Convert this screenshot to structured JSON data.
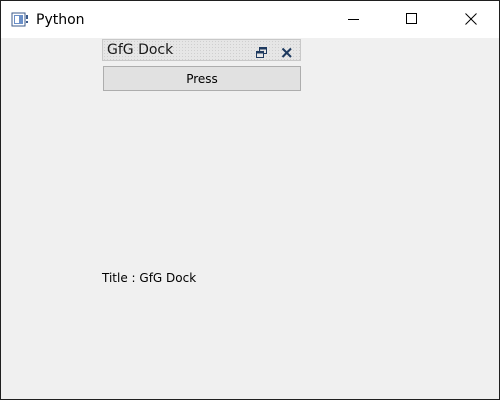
{
  "window": {
    "title": "Python",
    "icon": "python-app-icon",
    "controls": [
      "minimize-icon",
      "maximize-icon",
      "close-icon"
    ]
  },
  "dock": {
    "title": "GfG Dock",
    "float_icon": "float-icon",
    "close_icon": "close-icon"
  },
  "button": {
    "label": "Press"
  },
  "label": {
    "text": "Title : GfG Dock"
  },
  "colors": {
    "background": "#f0f0f0",
    "titlebar": "#ffffff",
    "button": "#e1e1e1",
    "dock_title_close": "#1e3a5f"
  }
}
